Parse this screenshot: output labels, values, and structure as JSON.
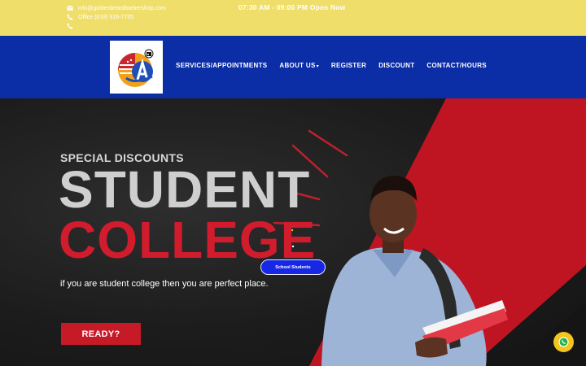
{
  "topbar": {
    "email": "info@goldenbeardbarbershop.com",
    "phone": "Office (818) 916-7735",
    "phone2": "",
    "hours": "07:30 AM - 09:00 PM Open Now"
  },
  "nav": {
    "items": [
      {
        "label": "SERVICES/APPOINTMENTS"
      },
      {
        "label": "ABOUT US"
      },
      {
        "label": "REGISTER"
      },
      {
        "label": "DISCOUNT"
      },
      {
        "label": "CONTACT/HOURS"
      }
    ]
  },
  "hero": {
    "eyebrow": "SPECIAL DISCOUNTS",
    "title_line1": "STUDENT",
    "title_line2": "COLLEGE",
    "subtitle": "if you are student college then you are perfect place.",
    "cta": "READY?",
    "badge": "School Students"
  },
  "colors": {
    "topbar": "#f0de6a",
    "navbar": "#0b2da6",
    "accent_red": "#c61a27",
    "badge_blue": "#1628e6",
    "whatsapp": "#f3c51e"
  },
  "icons": [
    "envelope-icon",
    "phone-icon",
    "chevron-down-icon",
    "whatsapp-icon"
  ]
}
